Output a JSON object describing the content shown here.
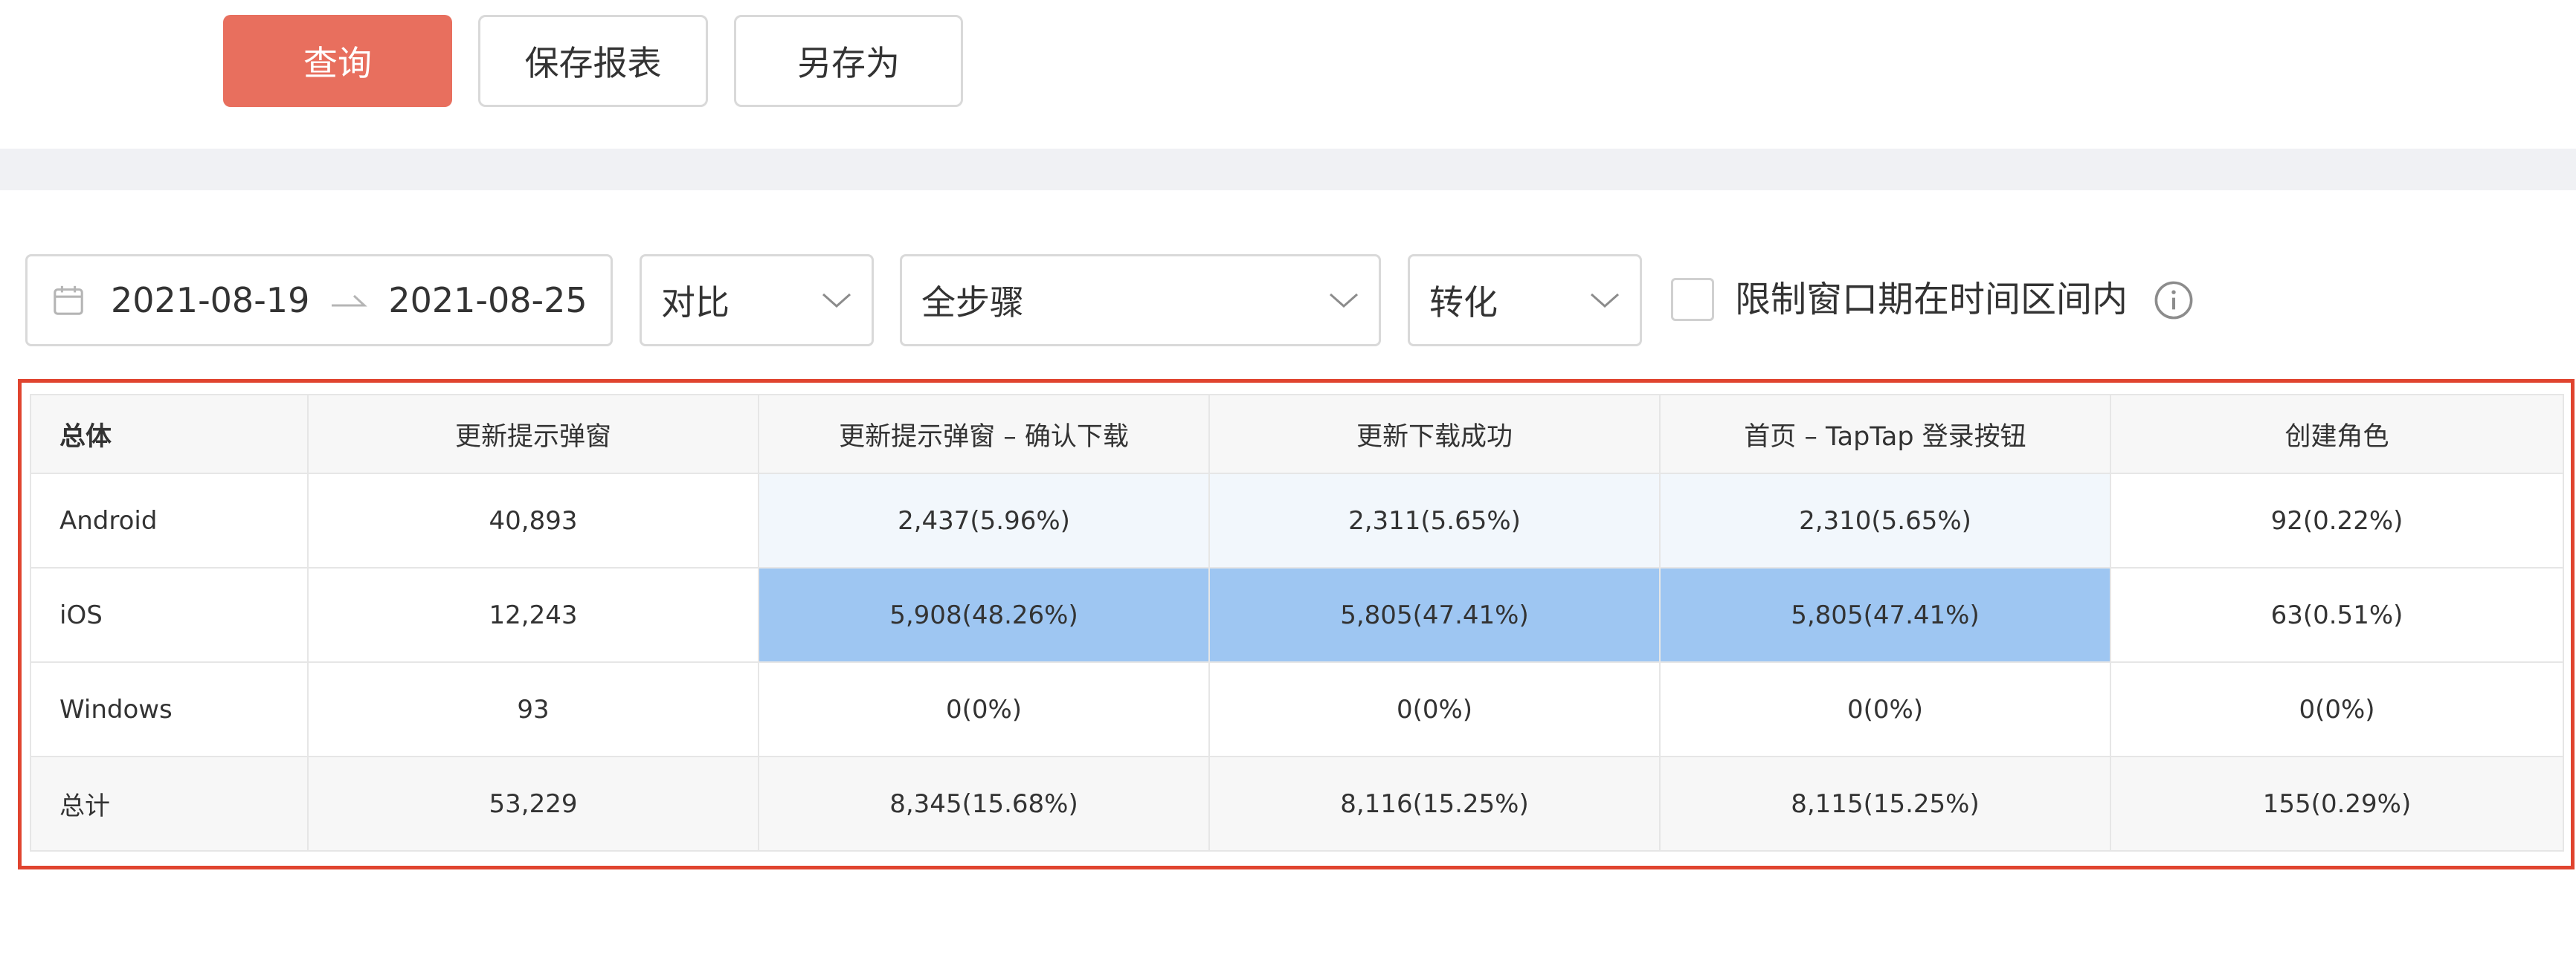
{
  "toolbar": {
    "query_label": "查询",
    "save_label": "保存报表",
    "save_as_label": "另存为"
  },
  "filters": {
    "date_start": "2021-08-19",
    "date_end": "2021-08-25",
    "compare_label": "对比",
    "steps_label": "全步骤",
    "conversion_label": "转化",
    "restrict_window_label": "限制窗口期在时间区间内"
  },
  "colors": {
    "primary": "#e86f5e",
    "highlight_light": "#f2f7fc",
    "highlight_strong": "#9ec6f2",
    "frame_red": "#e0442f"
  },
  "table": {
    "headers": [
      "总体",
      "更新提示弹窗",
      "更新提示弹窗 – 确认下载",
      "更新下载成功",
      "首页 – TapTap 登录按钮",
      "创建角色"
    ],
    "rows": [
      {
        "name": "Android",
        "cells": [
          "40,893",
          "2,437(5.96%)",
          "2,311(5.65%)",
          "2,310(5.65%)",
          "92(0.22%)"
        ]
      },
      {
        "name": "iOS",
        "cells": [
          "12,243",
          "5,908(48.26%)",
          "5,805(47.41%)",
          "5,805(47.41%)",
          "63(0.51%)"
        ]
      },
      {
        "name": "Windows",
        "cells": [
          "93",
          "0(0%)",
          "0(0%)",
          "0(0%)",
          "0(0%)"
        ]
      },
      {
        "name": "总计",
        "cells": [
          "53,229",
          "8,345(15.68%)",
          "8,116(15.25%)",
          "8,115(15.25%)",
          "155(0.29%)"
        ]
      }
    ]
  }
}
